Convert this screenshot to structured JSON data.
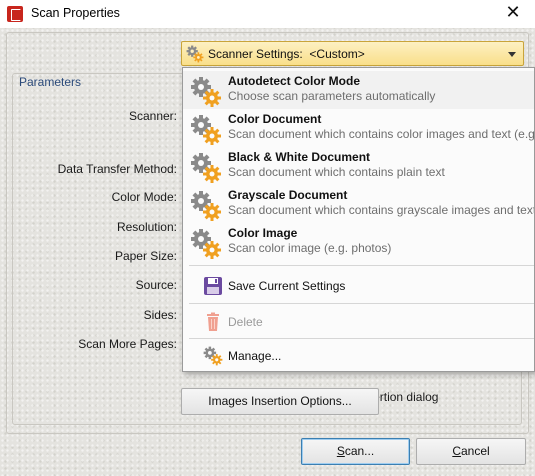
{
  "window": {
    "title": "Scan Properties",
    "close_glyph": "✕"
  },
  "scanner_settings": {
    "label": "Scanner Settings:",
    "value": "<Custom>",
    "icon": "gears-icon"
  },
  "parameters": {
    "title": "Parameters",
    "labels": {
      "scanner": "Scanner:",
      "data_transfer_method": "Data Transfer Method:",
      "color_mode": "Color Mode:",
      "resolution": "Resolution:",
      "paper_size": "Paper Size:",
      "source": "Source:",
      "sides": "Sides:",
      "scan_more_pages": "Scan More Pages:"
    },
    "after_scanning_checkbox": {
      "label": "After scanning, show images insertion dialog",
      "checked": false
    }
  },
  "images_insertion_button": "Images Insertion Options...",
  "footer": {
    "scan_button": {
      "label": "Scan...",
      "underline": "S"
    },
    "cancel_button": {
      "label": "Cancel",
      "underline": "C"
    }
  },
  "dropdown": {
    "presets": [
      {
        "title": "Autodetect Color Mode",
        "description": "Choose scan parameters automatically",
        "icon": "gears-icon"
      },
      {
        "title": "Color Document",
        "description": "Scan document which contains color images and text (e.g.",
        "icon": "gears-icon"
      },
      {
        "title": "Black & White Document",
        "description": "Scan document which contains plain text",
        "icon": "gears-icon"
      },
      {
        "title": "Grayscale Document",
        "description": "Scan document which contains grayscale images and text",
        "icon": "gears-icon"
      },
      {
        "title": "Color Image",
        "description": "Scan color image (e.g. photos)",
        "icon": "gears-icon"
      }
    ],
    "actions": {
      "save": {
        "label": "Save Current Settings",
        "icon": "floppy-disk-icon"
      },
      "delete": {
        "label": "Delete",
        "icon": "trash-icon",
        "disabled": true
      },
      "manage": {
        "label": "Manage...",
        "icon": "gears-icon"
      }
    }
  },
  "colors": {
    "accent_gold": "#f9df8a",
    "gear_grey": "#8a8a8a",
    "gear_orange": "#f0a020",
    "floppy_purple": "#6b4aa0",
    "trash_salmon": "#f0a090"
  }
}
